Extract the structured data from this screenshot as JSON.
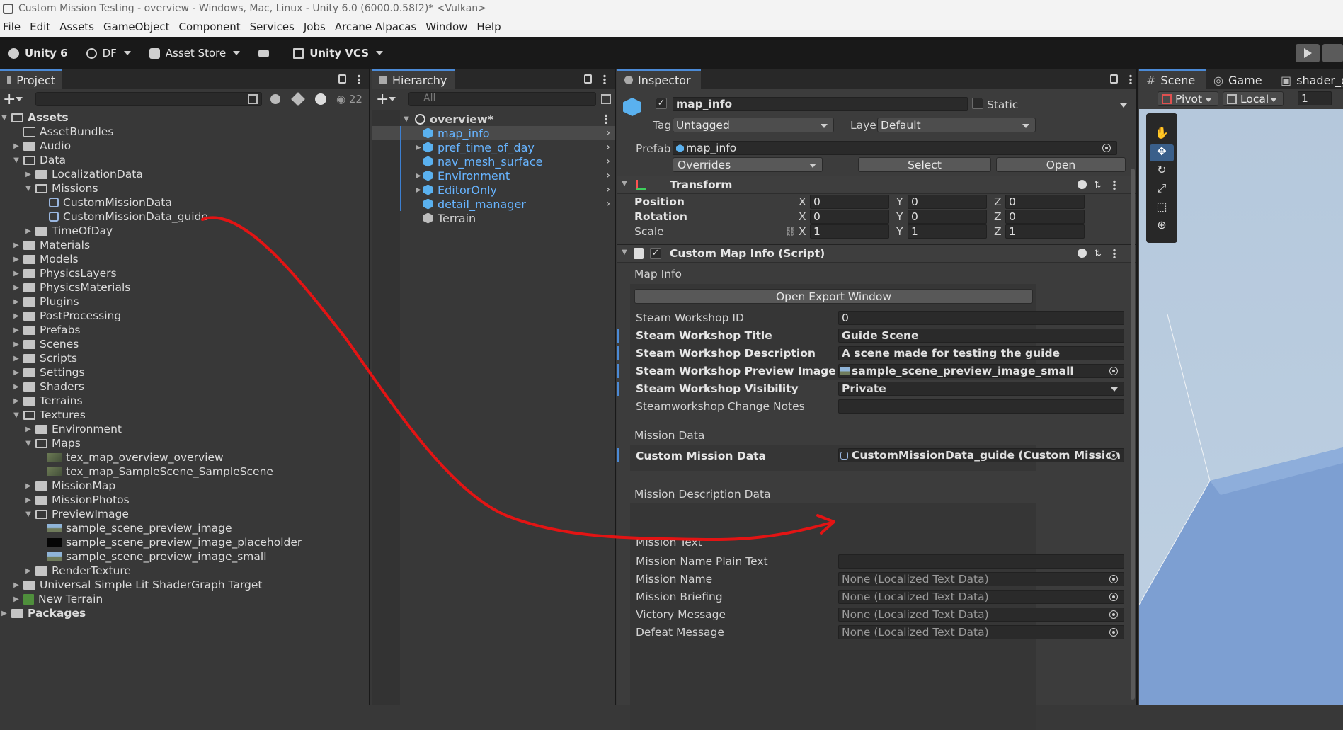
{
  "window": {
    "title": "Custom Mission Testing - overview - Windows, Mac, Linux - Unity 6.0 (6000.0.58f2)* <Vulkan>"
  },
  "menu": [
    "File",
    "Edit",
    "Assets",
    "GameObject",
    "Component",
    "Services",
    "Jobs",
    "Arcane Alpacas",
    "Window",
    "Help"
  ],
  "toolbar": {
    "unity": "Unity 6",
    "account": "DF",
    "asset_store": "Asset Store",
    "vcs": "Unity VCS"
  },
  "project": {
    "tab": "Project",
    "hidden_count": "22",
    "tree": [
      {
        "label": "Assets",
        "depth": 0,
        "arrow": "down",
        "icon": "folder-open",
        "bold": true
      },
      {
        "label": "AssetBundles",
        "depth": 1,
        "arrow": "",
        "icon": "folder-empty"
      },
      {
        "label": "Audio",
        "depth": 1,
        "arrow": "right",
        "icon": "folder"
      },
      {
        "label": "Data",
        "depth": 1,
        "arrow": "down",
        "icon": "folder-open"
      },
      {
        "label": "LocalizationData",
        "depth": 2,
        "arrow": "right",
        "icon": "folder"
      },
      {
        "label": "Missions",
        "depth": 2,
        "arrow": "down",
        "icon": "folder-open"
      },
      {
        "label": "CustomMissionData",
        "depth": 3,
        "arrow": "",
        "icon": "scriptable"
      },
      {
        "label": "CustomMissionData_guide",
        "depth": 3,
        "arrow": "",
        "icon": "scriptable"
      },
      {
        "label": "TimeOfDay",
        "depth": 2,
        "arrow": "right",
        "icon": "folder"
      },
      {
        "label": "Materials",
        "depth": 1,
        "arrow": "right",
        "icon": "folder"
      },
      {
        "label": "Models",
        "depth": 1,
        "arrow": "right",
        "icon": "folder"
      },
      {
        "label": "PhysicsLayers",
        "depth": 1,
        "arrow": "right",
        "icon": "folder"
      },
      {
        "label": "PhysicsMaterials",
        "depth": 1,
        "arrow": "right",
        "icon": "folder"
      },
      {
        "label": "Plugins",
        "depth": 1,
        "arrow": "right",
        "icon": "folder"
      },
      {
        "label": "PostProcessing",
        "depth": 1,
        "arrow": "right",
        "icon": "folder"
      },
      {
        "label": "Prefabs",
        "depth": 1,
        "arrow": "right",
        "icon": "folder"
      },
      {
        "label": "Scenes",
        "depth": 1,
        "arrow": "right",
        "icon": "folder"
      },
      {
        "label": "Scripts",
        "depth": 1,
        "arrow": "right",
        "icon": "folder"
      },
      {
        "label": "Settings",
        "depth": 1,
        "arrow": "right",
        "icon": "folder"
      },
      {
        "label": "Shaders",
        "depth": 1,
        "arrow": "right",
        "icon": "folder"
      },
      {
        "label": "Terrains",
        "depth": 1,
        "arrow": "right",
        "icon": "folder"
      },
      {
        "label": "Textures",
        "depth": 1,
        "arrow": "down",
        "icon": "folder-open"
      },
      {
        "label": "Environment",
        "depth": 2,
        "arrow": "right",
        "icon": "folder"
      },
      {
        "label": "Maps",
        "depth": 2,
        "arrow": "down",
        "icon": "folder-open"
      },
      {
        "label": "tex_map_overview_overview",
        "depth": 3,
        "arrow": "",
        "icon": "texture-map"
      },
      {
        "label": "tex_map_SampleScene_SampleScene",
        "depth": 3,
        "arrow": "",
        "icon": "texture-map"
      },
      {
        "label": "MissionMap",
        "depth": 2,
        "arrow": "right",
        "icon": "folder"
      },
      {
        "label": "MissionPhotos",
        "depth": 2,
        "arrow": "right",
        "icon": "folder"
      },
      {
        "label": "PreviewImage",
        "depth": 2,
        "arrow": "down",
        "icon": "folder-open"
      },
      {
        "label": "sample_scene_preview_image",
        "depth": 3,
        "arrow": "",
        "icon": "texture-sky"
      },
      {
        "label": "sample_scene_preview_image_placeholder",
        "depth": 3,
        "arrow": "",
        "icon": "texture-black"
      },
      {
        "label": "sample_scene_preview_image_small",
        "depth": 3,
        "arrow": "",
        "icon": "texture-sky"
      },
      {
        "label": "RenderTexture",
        "depth": 2,
        "arrow": "right",
        "icon": "folder"
      },
      {
        "label": "Universal Simple Lit ShaderGraph Target",
        "depth": 1,
        "arrow": "right",
        "icon": "folder"
      },
      {
        "label": "New Terrain",
        "depth": 1,
        "arrow": "right",
        "icon": "terrain"
      },
      {
        "label": "Packages",
        "depth": 0,
        "arrow": "right",
        "icon": "folder",
        "bold": true
      }
    ]
  },
  "hierarchy": {
    "tab": "Hierarchy",
    "search_placeholder": "All",
    "scene": "overview*",
    "items": [
      {
        "label": "map_info",
        "arrow": "",
        "blue": true,
        "selected": true,
        "chev": true
      },
      {
        "label": "pref_time_of_day",
        "arrow": "right",
        "blue": true,
        "chev": true
      },
      {
        "label": "nav_mesh_surface",
        "arrow": "",
        "blue": true,
        "chev": true
      },
      {
        "label": "Environment",
        "arrow": "right",
        "blue": true,
        "chev": true
      },
      {
        "label": "EditorOnly",
        "arrow": "right",
        "blue": true,
        "chev": true
      },
      {
        "label": "detail_manager",
        "arrow": "",
        "blue": true,
        "chev": true
      },
      {
        "label": "Terrain",
        "arrow": "",
        "blue": false,
        "chev": false
      }
    ]
  },
  "inspector": {
    "tab": "Inspector",
    "name": "map_info",
    "static": "Static",
    "tag_label": "Tag",
    "tag": "Untagged",
    "layer_label": "Layer",
    "layer": "Default",
    "prefab_label": "Prefab",
    "prefab": "map_info",
    "overrides": "Overrides",
    "select": "Select",
    "open": "Open",
    "transform": {
      "title": "Transform",
      "rows": [
        {
          "label": "Position",
          "x": "0",
          "y": "0",
          "z": "0",
          "bold": true
        },
        {
          "label": "Rotation",
          "x": "0",
          "y": "0",
          "z": "0",
          "bold": true
        },
        {
          "label": "Scale",
          "x": "1",
          "y": "1",
          "z": "1",
          "bold": false
        }
      ],
      "axis": {
        "x": "X",
        "y": "Y",
        "z": "Z"
      }
    },
    "script": {
      "title": "Custom Map Info (Script)",
      "map_info": "Map Info",
      "export_button": "Open Export Window",
      "fields": [
        {
          "label": "Steam Workshop ID",
          "value": "0",
          "bold": false,
          "modified": false
        },
        {
          "label": "Steam Workshop Title",
          "value": "Guide Scene",
          "bold": true,
          "modified": true
        },
        {
          "label": "Steam Workshop Description",
          "value": "A scene made for testing the guide",
          "bold": true,
          "modified": true
        },
        {
          "label": "Steam Workshop Preview Image",
          "value": "sample_scene_preview_image_small",
          "bold": true,
          "modified": true
        },
        {
          "label": "Steam Workshop Visibility",
          "value": "Private",
          "bold": true,
          "modified": true
        },
        {
          "label": "Steamworkshop Change Notes",
          "value": "",
          "bold": false,
          "modified": false
        }
      ],
      "mission_data": "Mission Data",
      "custom_mission_label": "Custom Mission Data",
      "custom_mission_value": "CustomMissionData_guide (Custom Mission Data",
      "mission_description": "Mission Description Data",
      "mission_text": "Mission Text",
      "text_fields": [
        {
          "label": "Mission Name Plain Text",
          "value": ""
        },
        {
          "label": "Mission Name",
          "value": "None (Localized Text Data)"
        },
        {
          "label": "Mission Briefing",
          "value": "None (Localized Text Data)"
        },
        {
          "label": "Victory Message",
          "value": "None (Localized Text Data)"
        },
        {
          "label": "Defeat Message",
          "value": "None (Localized Text Data)"
        }
      ]
    }
  },
  "scene": {
    "tab_scene": "Scene",
    "tab_game": "Game",
    "tab_shader": "shader_g",
    "pivot": "Pivot",
    "local": "Local",
    "snap": "1"
  },
  "annotation": {
    "color": "#e31414"
  }
}
